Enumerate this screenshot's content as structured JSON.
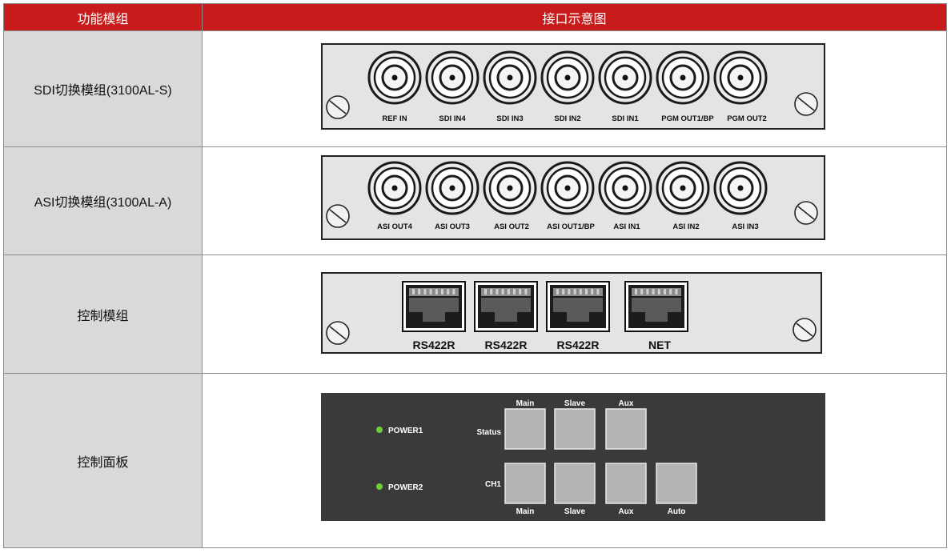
{
  "header": {
    "col1": "功能模组",
    "col2": "接口示意图"
  },
  "rows": [
    {
      "label": "SDI切换模组(3100AL-S)",
      "ports": [
        "REF IN",
        "SDI IN4",
        "SDI IN3",
        "SDI IN2",
        "SDI IN1",
        "PGM OUT1/BP",
        "PGM OUT2"
      ]
    },
    {
      "label": "ASI切换模组(3100AL-A)",
      "ports": [
        "ASI OUT4",
        "ASI OUT3",
        "ASI OUT2",
        "ASI OUT1/BP",
        "ASI IN1",
        "ASI IN2",
        "ASI IN3"
      ]
    },
    {
      "label": "控制模组",
      "ports": [
        "RS422R",
        "RS422R",
        "RS422R",
        "NET"
      ]
    },
    {
      "label": "控制面板",
      "panel": {
        "power1": "POWER1",
        "power2": "POWER2",
        "status_label": "Status",
        "ch1_label": "CH1",
        "top_labels": [
          "Main",
          "Slave",
          "Aux"
        ],
        "bottom_labels": [
          "Main",
          "Slave",
          "Aux",
          "Auto"
        ]
      }
    }
  ],
  "colors": {
    "header_bg": "#c81c1c",
    "label_bg": "#d9d9d9",
    "panel_bg": "#3a3a3a",
    "led": "#6fcf3b"
  }
}
